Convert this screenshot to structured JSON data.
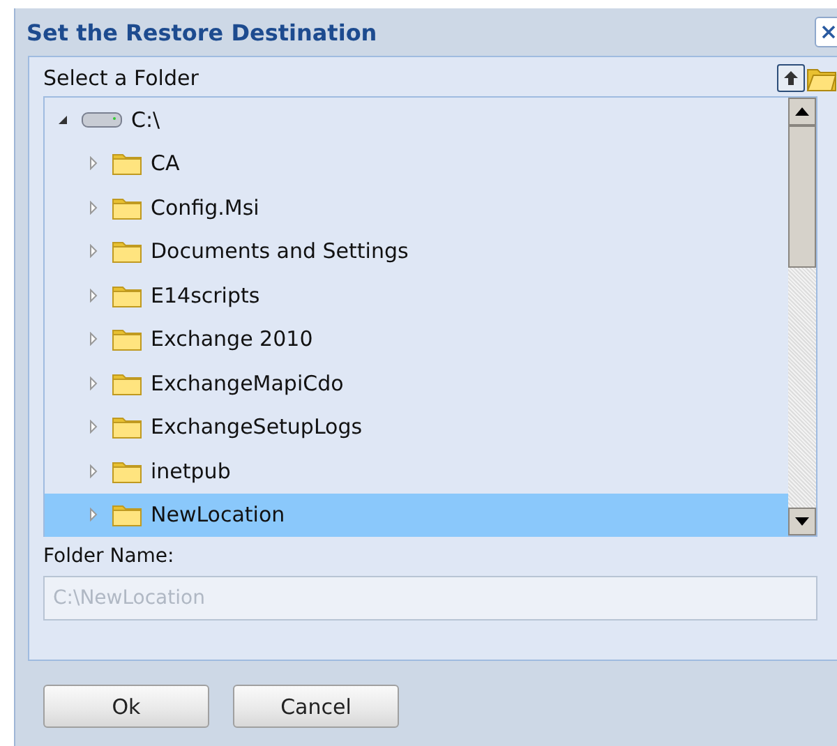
{
  "window": {
    "title": "Set the Restore Destination"
  },
  "panel": {
    "label": "Select a Folder"
  },
  "tree": [
    {
      "label": "C:\\",
      "expanded": true,
      "selected": false,
      "children": [
        {
          "label": "CA",
          "expanded": false,
          "selected": false
        },
        {
          "label": "Config.Msi",
          "expanded": false,
          "selected": false
        },
        {
          "label": "Documents and Settings",
          "expanded": false,
          "selected": false
        },
        {
          "label": "E14scripts",
          "expanded": false,
          "selected": false
        },
        {
          "label": "Exchange 2010",
          "expanded": false,
          "selected": false
        },
        {
          "label": "ExchangeMapiCdo",
          "expanded": false,
          "selected": false
        },
        {
          "label": "ExchangeSetupLogs",
          "expanded": false,
          "selected": false
        },
        {
          "label": "inetpub",
          "expanded": false,
          "selected": false
        },
        {
          "label": "NewLocation",
          "expanded": false,
          "selected": true
        }
      ]
    }
  ],
  "folder_name": {
    "label": "Folder Name:",
    "value": "C:\\NewLocation",
    "disabled": true
  },
  "buttons": [
    "Ok",
    "Cancel"
  ]
}
